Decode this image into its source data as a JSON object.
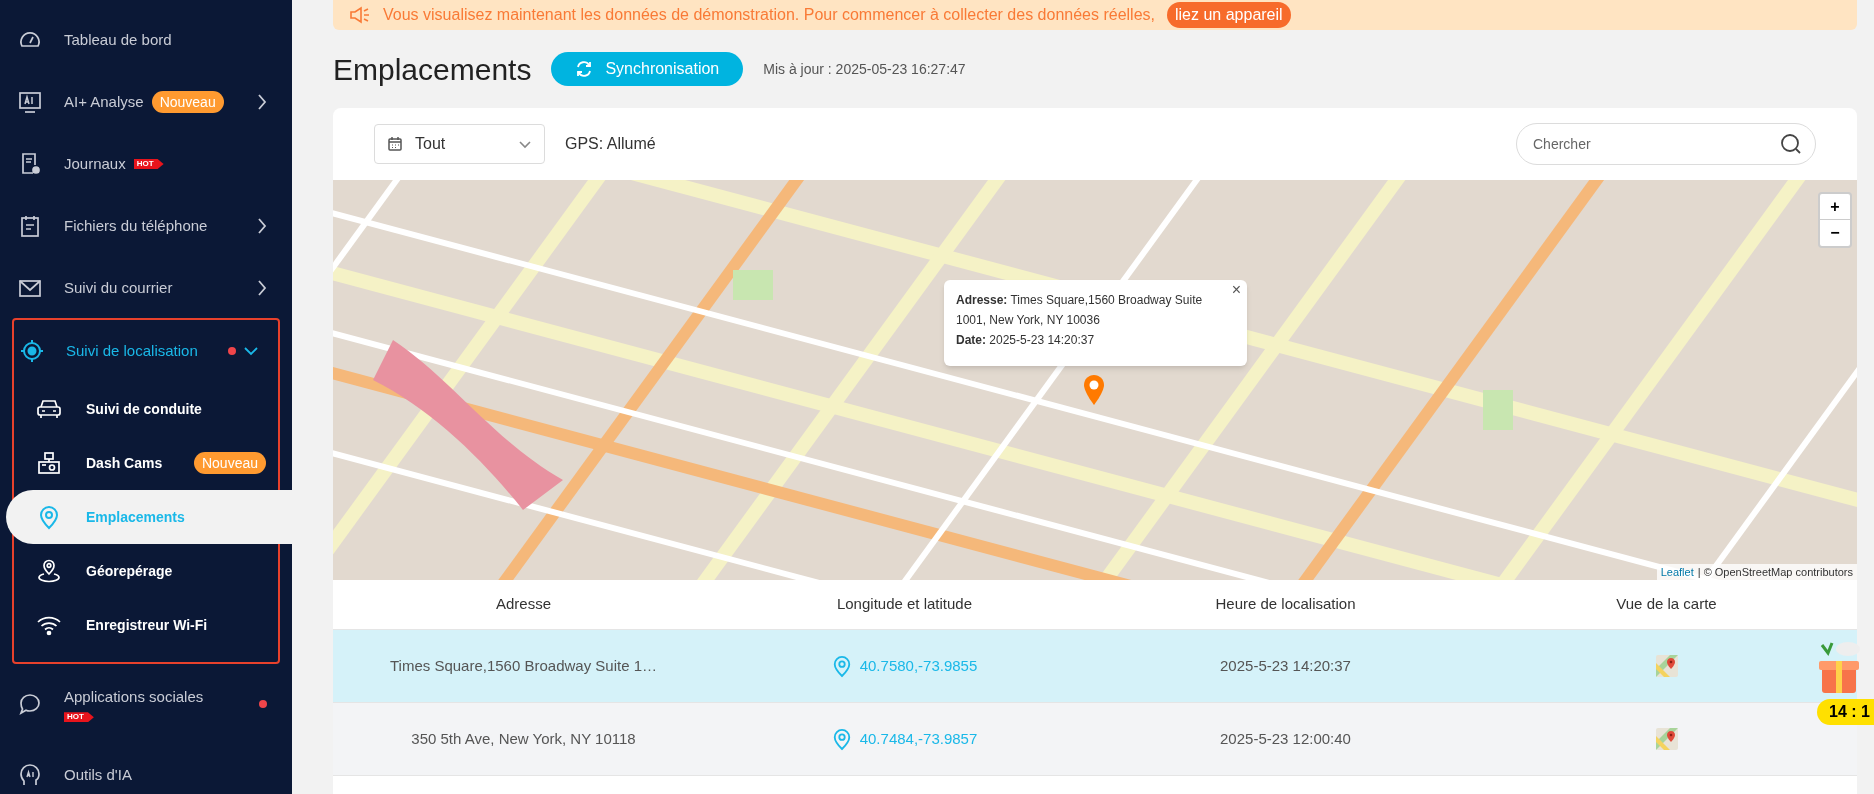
{
  "sidebar": {
    "items": [
      {
        "label": "Tableau de bord",
        "kind": "link",
        "dot": false
      },
      {
        "label": "AI+ Analyse",
        "kind": "group",
        "expanded": false,
        "badge": "Nouveau",
        "dot": false
      },
      {
        "label": "Journaux",
        "kind": "link",
        "hot_tag": "HOT",
        "dot": false
      },
      {
        "label": "Fichiers du téléphone",
        "kind": "group",
        "expanded": false,
        "dot": false
      },
      {
        "label": "Suivi du courrier",
        "kind": "group",
        "expanded": false,
        "dot": false
      },
      {
        "label": "Suivi de localisation",
        "kind": "group",
        "expanded": true,
        "dot": true,
        "children": [
          {
            "label": "Suivi de conduite",
            "selected": false
          },
          {
            "label": "Dash Cams",
            "selected": false,
            "badge": "Nouveau"
          },
          {
            "label": "Emplacements",
            "selected": true
          },
          {
            "label": "Géorepérage",
            "selected": false
          },
          {
            "label": "Enregistreur Wi-Fi",
            "selected": false
          }
        ]
      },
      {
        "label": "Applications sociales",
        "kind": "link",
        "hot_tag": "HOT",
        "dot": true
      },
      {
        "label": "Outils d'IA",
        "kind": "link",
        "dot": false
      }
    ]
  },
  "banner": {
    "text": "Vous visualisez maintenant les données de démonstration. Pour commencer à collecter des données réelles,",
    "link": "liez un appareil"
  },
  "page": {
    "title": "Emplacements",
    "sync_button": "Synchronisation",
    "updated": "Mis à jour : 2025-05-23 16:27:47"
  },
  "toolbar": {
    "filter": "Tout",
    "gps_status": "GPS: Allumé",
    "search": {
      "placeholder": "Chercher"
    }
  },
  "map": {
    "popup": {
      "address_label": "Adresse:",
      "address": "Times Square,1560 Broadway Suite 1001, New York, NY 10036",
      "date_label": "Date:",
      "date": "2025-5-23 14:20:37",
      "close": "×"
    },
    "zoom_in": "+",
    "zoom_out": "−",
    "attribution_link": "Leaflet",
    "attribution": "| © OpenStreetMap contributors"
  },
  "table": {
    "columns": [
      "Adresse",
      "Longitude et latitude",
      "Heure de localisation",
      "Vue de la carte"
    ],
    "rows": [
      {
        "address": "Times Square,1560 Broadway Suite 1…",
        "coordinates": "40.7580,-73.9855",
        "time": "2025-5-23 14:20:37",
        "selected": true
      },
      {
        "address": "350 5th Ave, New York, NY 10118",
        "coordinates": "40.7484,-73.9857",
        "time": "2025-5-23 12:00:40",
        "selected": false
      }
    ]
  },
  "widget": {
    "timer": "14 : 1"
  }
}
